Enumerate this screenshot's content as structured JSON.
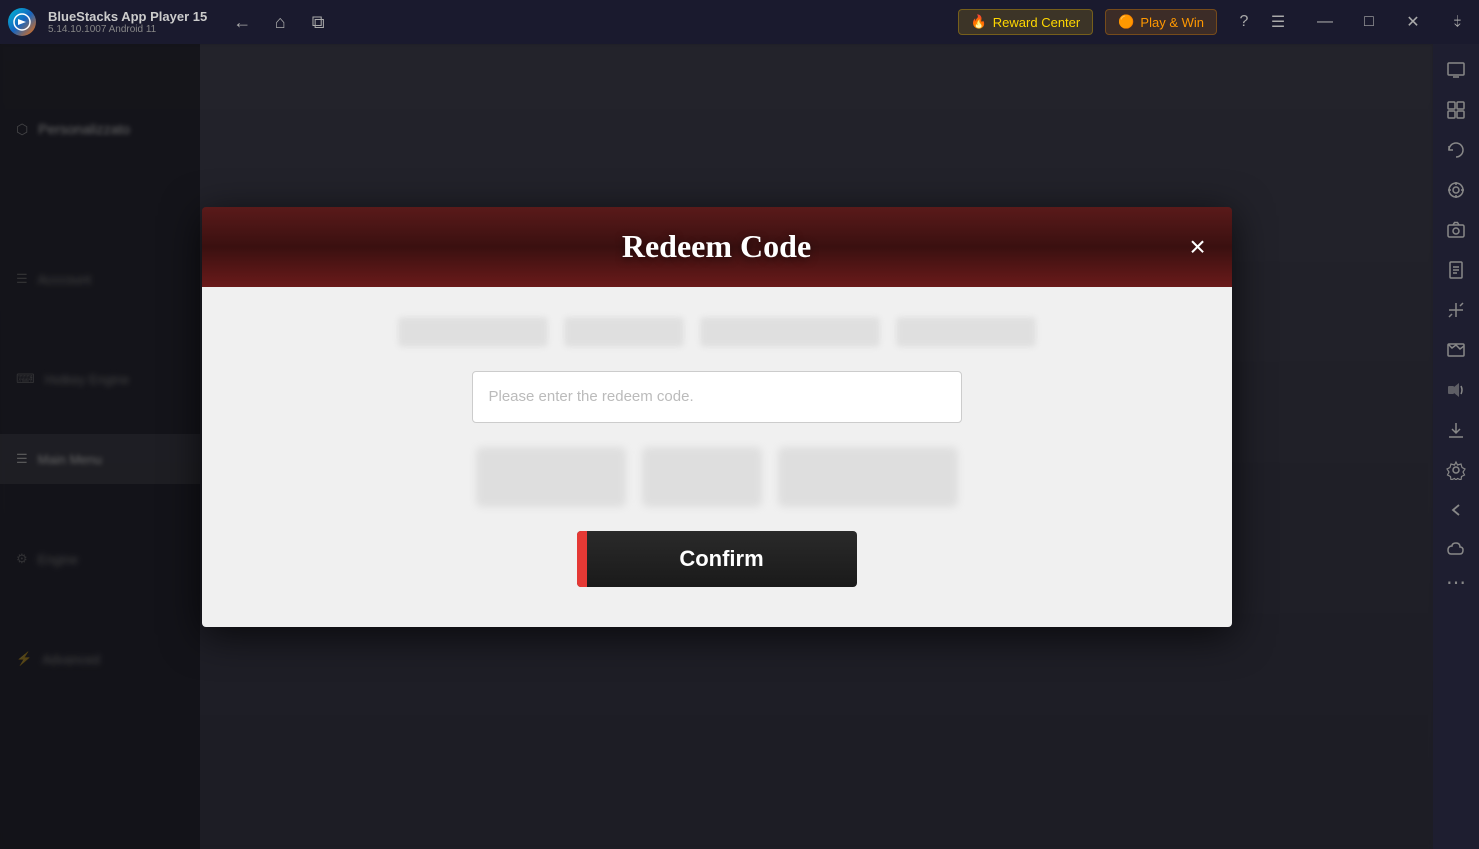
{
  "app": {
    "name": "BlueStacks App Player 15",
    "version": "5.14.10.1007  Android 11"
  },
  "titlebar": {
    "reward_center": "Reward Center",
    "play_and_win": "Play & Win",
    "nav": {
      "back": "←",
      "home": "⌂",
      "tabs": "⧉"
    },
    "window_controls": {
      "help": "?",
      "menu": "☰",
      "minimize": "—",
      "maximize": "☐",
      "close": "✕",
      "snap": "❐"
    }
  },
  "modal": {
    "title": "Redeem Code",
    "close_label": "×",
    "input_placeholder": "Please enter the redeem code.",
    "confirm_label": "Confirm"
  },
  "sidebar_right": {
    "icons": [
      "▣",
      "⊞",
      "↺",
      "⌖",
      "📋",
      "⊡",
      "↔",
      "↕",
      "⊞",
      "↙",
      "⚙",
      "←",
      "☁",
      "⋯"
    ]
  }
}
